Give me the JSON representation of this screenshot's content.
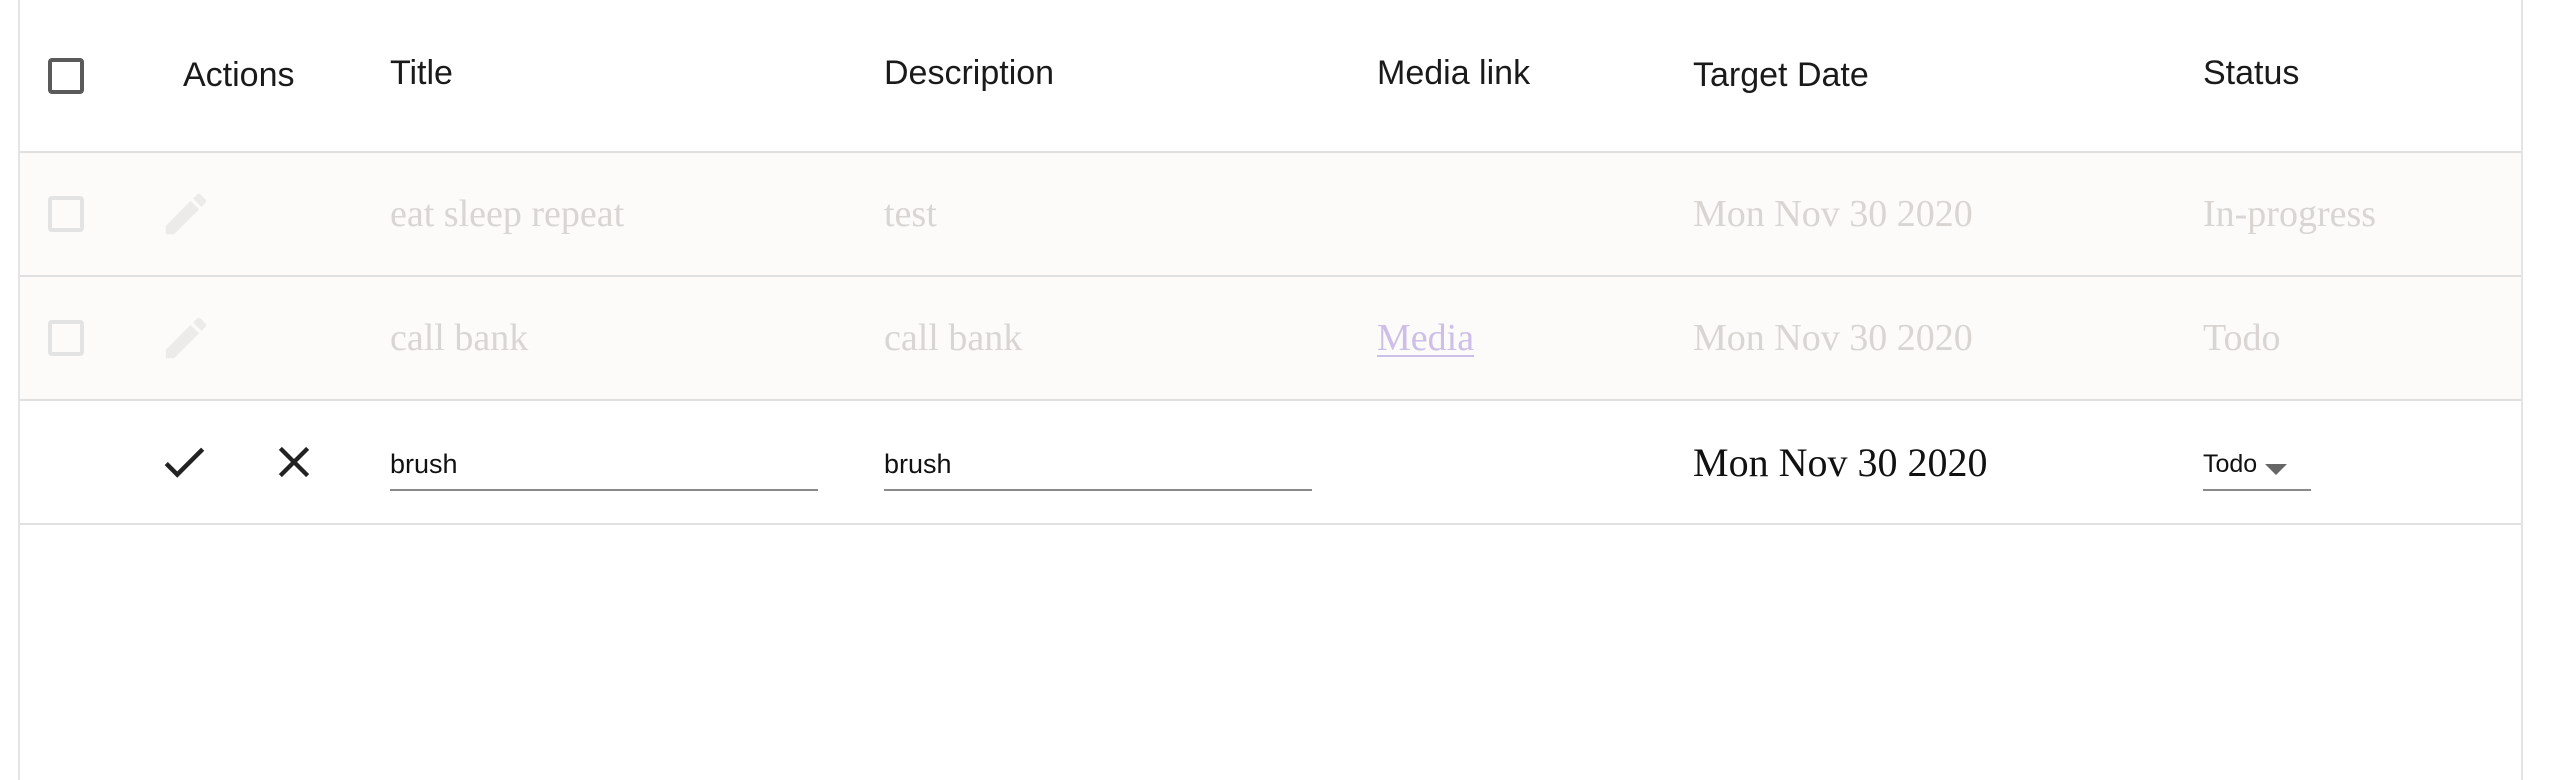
{
  "header": {
    "actions": "Actions",
    "title": "Title",
    "description": "Description",
    "media_link": "Media link",
    "target_date": "Target Date",
    "status": "Status"
  },
  "rows": [
    {
      "title": "eat sleep repeat",
      "description": "test",
      "media_link": "",
      "target_date": "Mon Nov 30 2020",
      "status": "In-progress"
    },
    {
      "title": "call bank",
      "description": "call bank",
      "media_link": "Media",
      "target_date": "Mon Nov 30 2020",
      "status": "Todo"
    }
  ],
  "editing_row": {
    "title_value": "brush",
    "description_value": "brush",
    "target_date": "Mon Nov 30 2020",
    "status_value": "Todo"
  },
  "icons": {
    "header_checkbox": "checkbox-icon",
    "edit": "pencil-icon",
    "save": "check-icon",
    "cancel": "close-icon",
    "select_caret": "caret-down-icon"
  },
  "colors": {
    "disabled_text": "#d9d5d2",
    "disabled_row_bg": "#fcfbfa",
    "link_disabled": "#cdbfe8",
    "divider": "#e0e0e0"
  }
}
